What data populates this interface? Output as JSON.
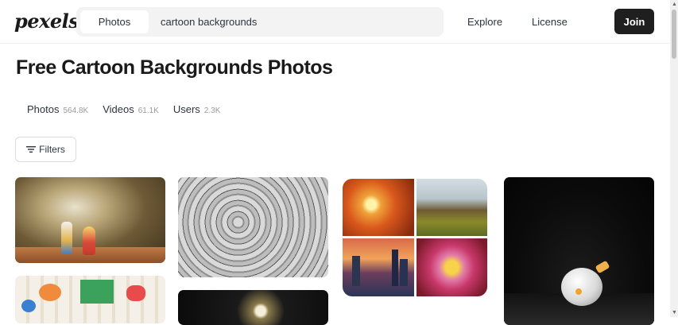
{
  "header": {
    "logo": "pexels",
    "search": {
      "type_label": "Photos",
      "query": "cartoon backgrounds"
    },
    "nav": {
      "explore": "Explore",
      "license": "License",
      "join": "Join"
    }
  },
  "page": {
    "title": "Free Cartoon Backgrounds Photos",
    "tabs": [
      {
        "label": "Photos",
        "count": "564.8K"
      },
      {
        "label": "Videos",
        "count": "61.1K"
      },
      {
        "label": "Users",
        "count": "2.3K"
      }
    ],
    "filters_label": "Filters"
  },
  "icons": {
    "filters": "filter-icon",
    "scroll_up": "scroll-up-arrow",
    "scroll_down": "scroll-down-arrow"
  },
  "photos": [
    {
      "subject": "toy figures on wooden table"
    },
    {
      "subject": "colorful kids drawings"
    },
    {
      "subject": "black and white doodle art"
    },
    {
      "subject": "dark scene with light"
    },
    {
      "subject": "collage: flower, mountain, city skyline, flowers"
    },
    {
      "subject": "white toy figure in dark"
    }
  ],
  "colors": {
    "join_bg": "#1f1f1f",
    "text": "#2c343e",
    "search_bg": "#f3f3f3"
  }
}
